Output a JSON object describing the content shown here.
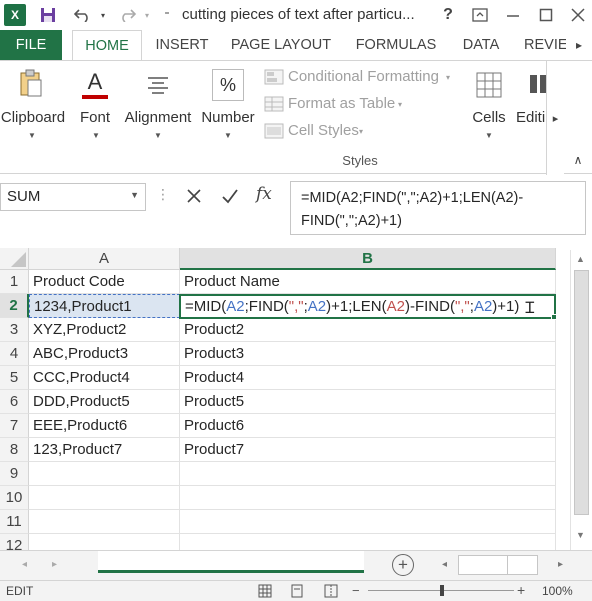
{
  "window": {
    "title": "cutting pieces of text after particu...",
    "app_logo": "X",
    "help": "?",
    "icons": [
      "excel-icon",
      "save-icon",
      "undo-icon",
      "redo-icon",
      "customize-icon",
      "ribbon-display-icon",
      "minimize-icon",
      "maximize-icon",
      "close-icon"
    ]
  },
  "tabs": [
    "FILE",
    "HOME",
    "INSERT",
    "PAGE LAYOUT",
    "FORMULAS",
    "DATA",
    "REVIEW"
  ],
  "ribbon": {
    "clipboard": "Clipboard",
    "font": "Font",
    "alignment": "Alignment",
    "number": "Number",
    "number_glyph": "%",
    "font_glyph": "A",
    "conditional_formatting": "Conditional Formatting",
    "format_as_table": "Format as Table",
    "cell_styles": "Cell Styles",
    "styles_group": "Styles",
    "cells": "Cells",
    "editing": "Editi"
  },
  "formula_bar": {
    "name_box": "SUM",
    "fx": "fx",
    "formula_line1": "=MID(A2;FIND(\",\";A2)+1;LEN(A2)-",
    "formula_line2": "FIND(\",\";A2)+1)"
  },
  "sheet": {
    "columns": [
      "A",
      "B"
    ],
    "rows": [
      {
        "n": "1",
        "a": "Product Code",
        "b": "Product Name"
      },
      {
        "n": "2",
        "a": "1234,Product1",
        "b": ""
      },
      {
        "n": "3",
        "a": "XYZ,Product2",
        "b": "Product2"
      },
      {
        "n": "4",
        "a": "ABC,Product3",
        "b": "Product3"
      },
      {
        "n": "5",
        "a": "CCC,Product4",
        "b": "Product4"
      },
      {
        "n": "6",
        "a": "DDD,Product5",
        "b": "Product5"
      },
      {
        "n": "7",
        "a": "EEE,Product6",
        "b": "Product6"
      },
      {
        "n": "8",
        "a": "123,Product7",
        "b": "Product7"
      },
      {
        "n": "9",
        "a": "",
        "b": ""
      },
      {
        "n": "10",
        "a": "",
        "b": ""
      },
      {
        "n": "11",
        "a": "",
        "b": ""
      },
      {
        "n": "12",
        "a": "",
        "b": ""
      }
    ],
    "edit_formula": {
      "p1": "=MID(",
      "r1": "A2",
      "p2": ";FIND(",
      "q1": "\",\"",
      "p3": ";",
      "r2": "A2",
      "p4": ")+1;LEN(",
      "r3": "A2",
      "p5": ")-FIND(",
      "q2": "\",\"",
      "p6": ";",
      "r4": "A2",
      "p7": ")+1)"
    },
    "colors": {
      "ref": "#4472c4",
      "ref2": "#c0504d",
      "accent": "#217346"
    }
  },
  "status": {
    "mode": "EDIT",
    "zoom": "100%"
  }
}
